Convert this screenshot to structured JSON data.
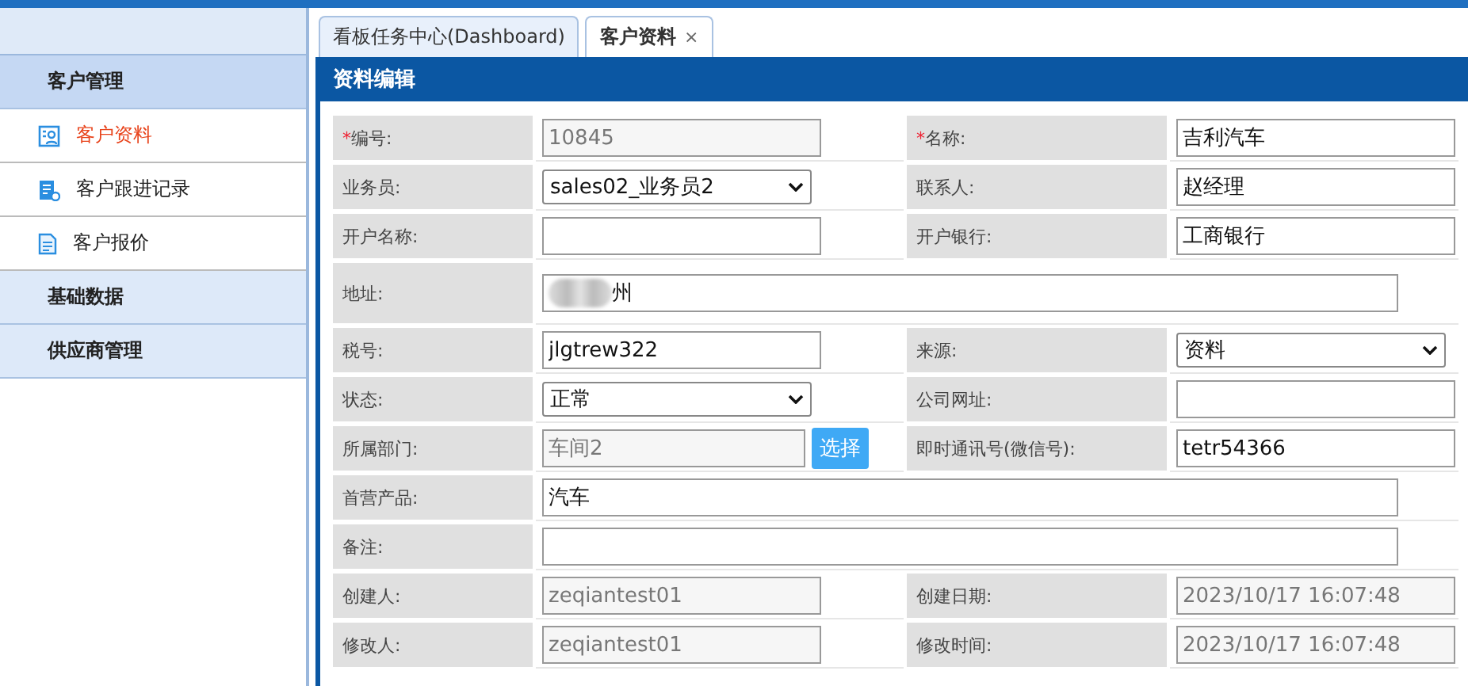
{
  "sidebar": {
    "groups": [
      {
        "label": "客户管理",
        "expanded": true,
        "items": [
          {
            "label": "客户资料",
            "selected": true
          },
          {
            "label": "客户跟进记录",
            "selected": false
          },
          {
            "label": "客户报价",
            "selected": false
          }
        ]
      },
      {
        "label": "基础数据",
        "expanded": false
      },
      {
        "label": "供应商管理",
        "expanded": false
      }
    ]
  },
  "tabs": [
    {
      "label": "看板任务中心(Dashboard)",
      "selected": false
    },
    {
      "label": "客户资料",
      "selected": true,
      "close": "×"
    }
  ],
  "panel": {
    "title": "资料编辑"
  },
  "form": [
    [
      {
        "mark": "*",
        "label": "编号:",
        "kind": "readonly",
        "value": "10845"
      },
      {
        "mark": "*",
        "label": "名称:",
        "kind": "text",
        "value": "吉利汽车"
      }
    ],
    [
      {
        "label": "业务员:",
        "kind": "select",
        "value": "sales02_业务员2"
      },
      {
        "label": "联系人:",
        "kind": "text",
        "value": "赵经理"
      }
    ],
    [
      {
        "label": "开户名称:",
        "kind": "text"
      },
      {
        "label": "开户银行:",
        "kind": "text",
        "value": "工商银行"
      }
    ],
    [
      {
        "label": "地址:",
        "kind": "wide",
        "value": "州",
        "redacted": true
      }
    ],
    [
      {
        "label": "税号:",
        "kind": "text",
        "value": "jlgtrew322"
      },
      {
        "label": "来源:",
        "kind": "select",
        "value": "资料"
      }
    ],
    [
      {
        "label": "状态:",
        "kind": "select",
        "value": "正常"
      },
      {
        "label": "公司网址:",
        "kind": "text"
      }
    ],
    [
      {
        "label": "所属部门:",
        "kind": "picker",
        "value": "车间2",
        "button": "选择"
      },
      {
        "label": "即时通讯号(微信号):",
        "kind": "text",
        "value": "tetr54366"
      }
    ],
    [
      {
        "label": "首营产品:",
        "kind": "wide",
        "value": "汽车"
      }
    ],
    [
      {
        "label": "备注:",
        "kind": "wide"
      }
    ],
    [
      {
        "label": "创建人:",
        "kind": "readonly",
        "value": "zeqiantest01"
      },
      {
        "label": "创建日期:",
        "kind": "readonly",
        "value": "2023/10/17 16:07:48"
      }
    ],
    [
      {
        "label": "修改人:",
        "kind": "readonly",
        "value": "zeqiantest01"
      },
      {
        "label": "修改时间:",
        "kind": "readonly",
        "value": "2023/10/17 16:07:48"
      }
    ]
  ]
}
